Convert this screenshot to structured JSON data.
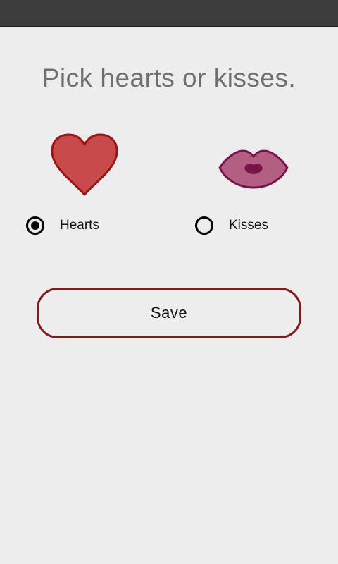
{
  "title": "Pick hearts or kisses.",
  "options": [
    {
      "label": "Hearts",
      "selected": true,
      "icon": "heart-icon"
    },
    {
      "label": "Kisses",
      "selected": false,
      "icon": "lips-icon"
    }
  ],
  "save_label": "Save",
  "colors": {
    "background": "#ededed",
    "status_bar": "#3c3c3c",
    "heart_fill": "#c84a4a",
    "heart_stroke": "#9b1515",
    "lips_fill": "#b35f81",
    "lips_stroke": "#7a1347",
    "button_border": "#8b1a1a"
  }
}
